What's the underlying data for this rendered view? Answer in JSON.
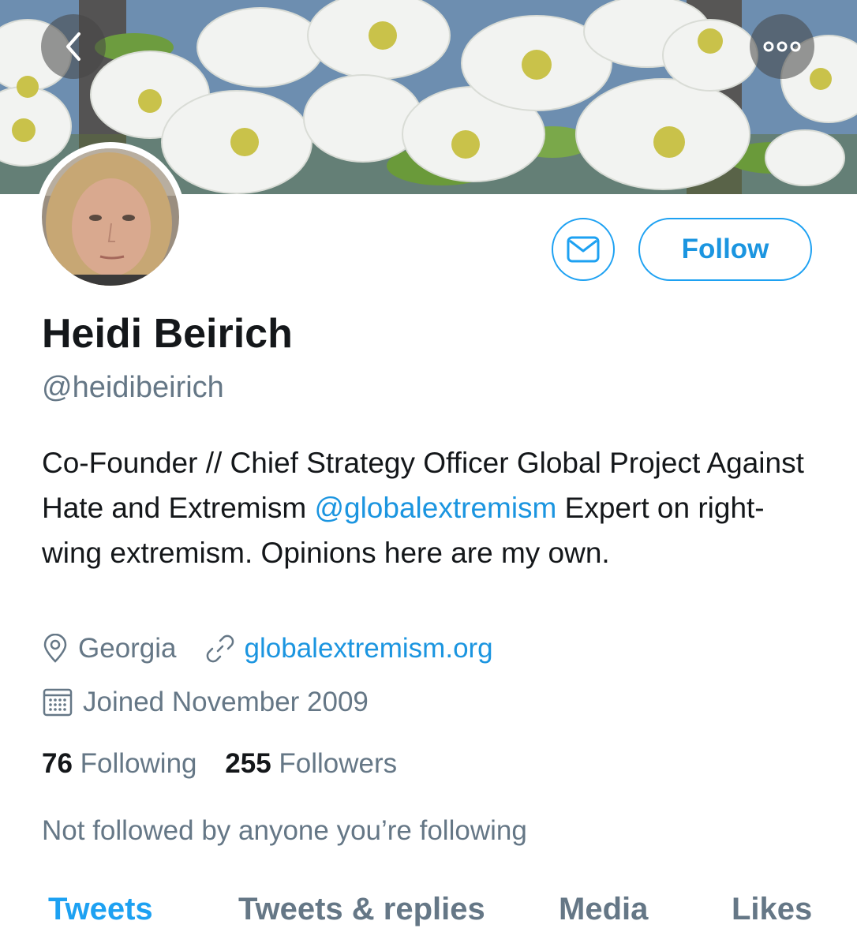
{
  "header": {
    "back_icon": "chevron-left-icon",
    "more_icon": "ellipsis-icon"
  },
  "actions": {
    "message_icon": "envelope-icon",
    "follow_label": "Follow"
  },
  "profile": {
    "name": "Heidi Beirich",
    "handle": "@heidibeirich",
    "bio_text": "Co-Founder // Chief Strategy Officer Global Project Against Hate and Extremism ",
    "bio_mention": "@globalextremism",
    "bio_tail": " Expert on right-wing extremism. Opinions here are my own.",
    "location": "Georgia",
    "website": "globalextremism.org",
    "joined": "Joined November 2009",
    "following_count": "76",
    "following_label": "Following",
    "followers_count": "255",
    "followers_label": "Followers",
    "mutuals_note": "Not followed by anyone you’re following"
  },
  "tabs": [
    {
      "label": "Tweets",
      "active": true
    },
    {
      "label": "Tweets & replies",
      "active": false
    },
    {
      "label": "Media",
      "active": false
    },
    {
      "label": "Likes",
      "active": false
    }
  ],
  "colors": {
    "accent": "#1da1f2",
    "link": "#1b95e0",
    "muted": "#657786",
    "text": "#14171a"
  }
}
